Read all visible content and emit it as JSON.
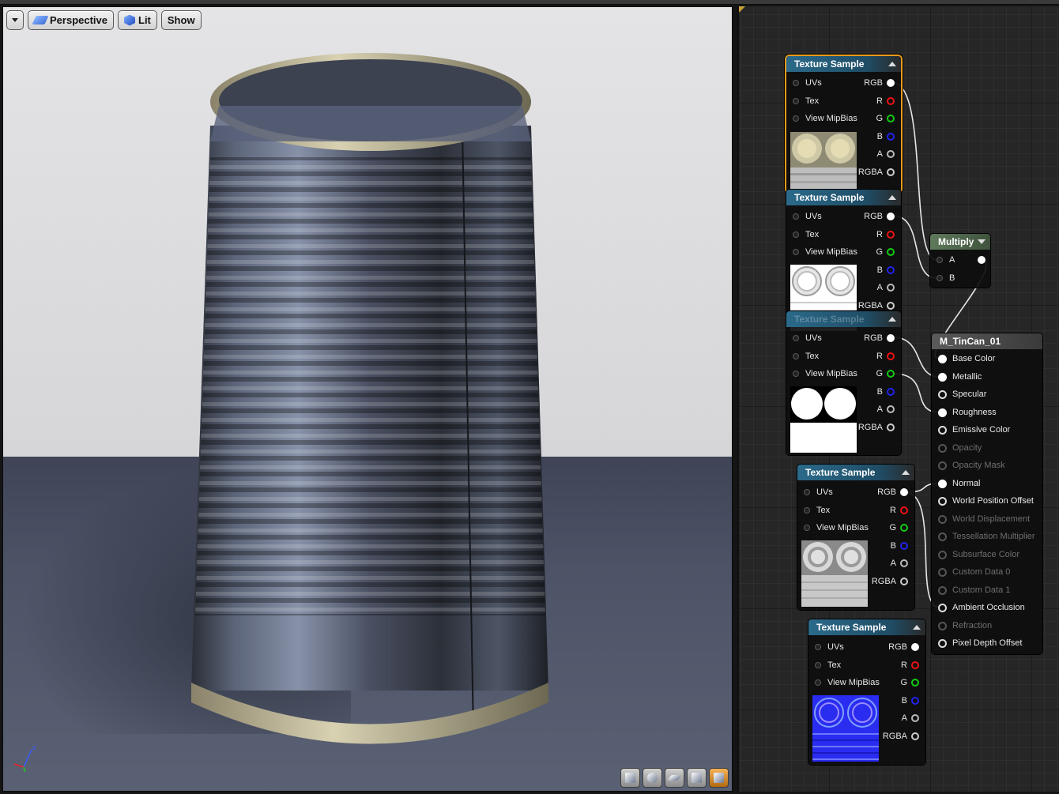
{
  "viewport": {
    "dropdown_label": "",
    "perspective_label": "Perspective",
    "lit_label": "Lit",
    "show_label": "Show",
    "axis_z_label": "z"
  },
  "texture_node": {
    "title": "Texture Sample",
    "inputs": [
      "UVs",
      "Tex",
      "View MipBias"
    ],
    "outputs": [
      "RGB",
      "R",
      "G",
      "B",
      "A",
      "RGBA"
    ]
  },
  "multiply_node": {
    "title": "Multiply",
    "inputs": [
      "A",
      "B"
    ]
  },
  "material_node": {
    "title": "M_TinCan_01",
    "inputs": [
      {
        "label": "Base Color",
        "enabled": true
      },
      {
        "label": "Metallic",
        "enabled": true
      },
      {
        "label": "Specular",
        "enabled": true
      },
      {
        "label": "Roughness",
        "enabled": true
      },
      {
        "label": "Emissive Color",
        "enabled": true
      },
      {
        "label": "Opacity",
        "enabled": false
      },
      {
        "label": "Opacity Mask",
        "enabled": false
      },
      {
        "label": "Normal",
        "enabled": true
      },
      {
        "label": "World Position Offset",
        "enabled": true
      },
      {
        "label": "World Displacement",
        "enabled": false
      },
      {
        "label": "Tessellation Multiplier",
        "enabled": false
      },
      {
        "label": "Subsurface Color",
        "enabled": false
      },
      {
        "label": "Custom Data 0",
        "enabled": false
      },
      {
        "label": "Custom Data 1",
        "enabled": false
      },
      {
        "label": "Ambient Occlusion",
        "enabled": true
      },
      {
        "label": "Refraction",
        "enabled": false
      },
      {
        "label": "Pixel Depth Offset",
        "enabled": true
      }
    ]
  },
  "colors": {
    "selection": "#e89a1e",
    "texture_header": "#2b6a8a",
    "multiply_header": "#5f7a5c",
    "material_header": "#5a5a5a",
    "wire": "#e8e8e8"
  }
}
